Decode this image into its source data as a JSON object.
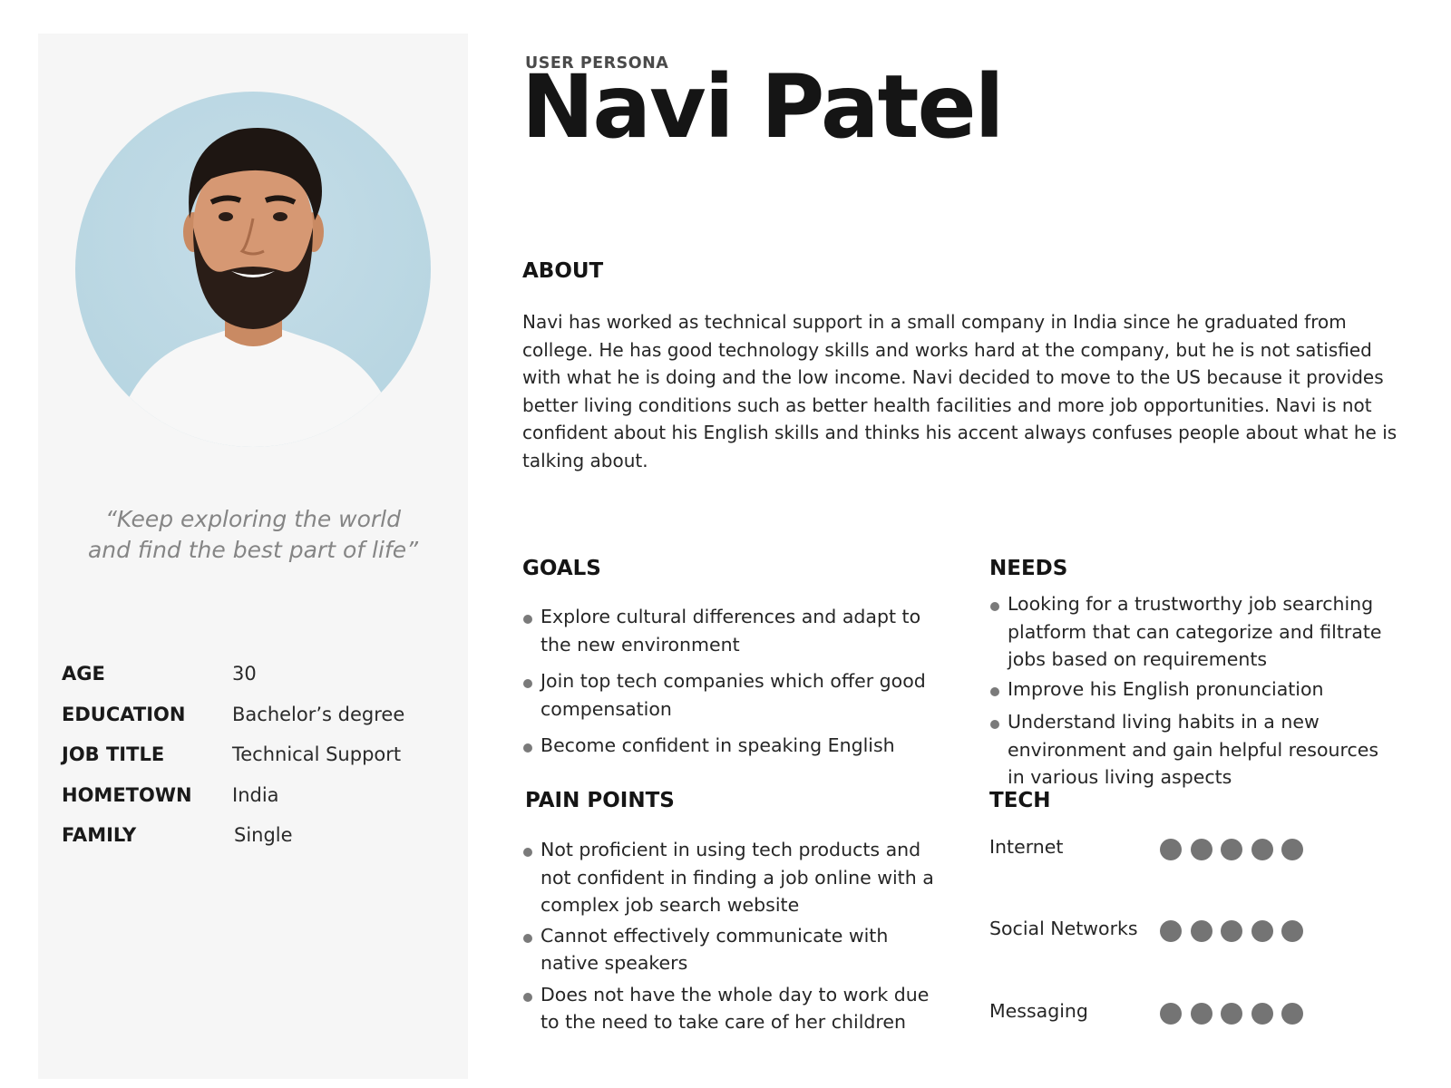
{
  "persona": {
    "kicker": "USER PERSONA",
    "name": "Navi Patel",
    "quote": "“Keep exploring the world and find the best part of life”",
    "facts": [
      {
        "label": "AGE",
        "value": "30"
      },
      {
        "label": "EDUCATION",
        "value": "Bachelor’s degree"
      },
      {
        "label": "JOB TITLE",
        "value": "Technical Support"
      },
      {
        "label": "HOMETOWN",
        "value": "India"
      },
      {
        "label": "FAMILY",
        "value": "Single"
      }
    ]
  },
  "about": {
    "title": "ABOUT",
    "text": "Navi has worked as technical support in a small company in India since he graduated from college. He has good technology skills and works hard at the company, but he is not satisfied with what he is doing and the low income. Navi decided to move to the US because it provides better living conditions such as better health facilities and more job opportunities. Navi is not confident about his English skills and thinks his accent always confuses people about what he is talking about."
  },
  "goals": {
    "title": "GOALS",
    "items": [
      "Explore cultural differences and adapt to the new environment",
      "Join top tech companies which offer good compensation",
      "Become confident in speaking English"
    ]
  },
  "needs": {
    "title": "NEEDS",
    "items": [
      "Looking for a trustworthy job searching platform that can categorize and filtrate jobs based on requirements",
      "Improve his English pronunciation",
      "Understand living habits in a new environment and gain helpful resources in various living aspects"
    ]
  },
  "pain_points": {
    "title": "PAIN POINTS",
    "items": [
      "Not proficient in using tech products and not confident in finding a job online with a complex job search website",
      "Cannot effectively communicate with native speakers",
      "Does not have the whole day to work due to the need to take care of her children"
    ]
  },
  "tech": {
    "title": "TECH",
    "items": [
      {
        "label": "Internet",
        "rating": 5,
        "max": 5
      },
      {
        "label": "Social Networks",
        "rating": 5,
        "max": 5
      },
      {
        "label": "Messaging",
        "rating": 5,
        "max": 5
      }
    ],
    "dot_color": "#747474"
  },
  "colors": {
    "sidebar_bg": "#f6f6f6",
    "photo_bg": "#b3d3df",
    "heading": "#151515",
    "quote": "#858585"
  }
}
